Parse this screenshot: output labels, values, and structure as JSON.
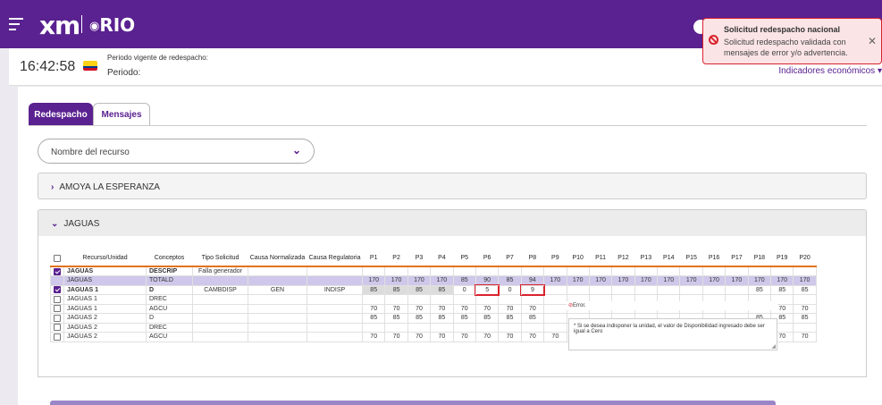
{
  "header": {
    "logo_left": "xm",
    "logo_right": "RIO"
  },
  "info": {
    "clock": "16:42:58",
    "period_title": "Periodo vigente de redespacho:",
    "period_label": "Periodo:",
    "indicators": "Indicadores económicos"
  },
  "tabs": [
    {
      "label": "Redespacho"
    },
    {
      "label": "Mensajes"
    }
  ],
  "filter": {
    "placeholder": "Nombre del recurso"
  },
  "accordions": [
    {
      "title": "AMOYA LA ESPERANZA"
    },
    {
      "title": "JAGUAS"
    }
  ],
  "table": {
    "headers": [
      "",
      "Recurso/Unidad",
      "Conceptos",
      "Tipo Solicitud",
      "Causa Normalizada",
      "Causa Regulatoria",
      "P1",
      "P2",
      "P3",
      "P4",
      "P5",
      "P6",
      "P7",
      "P8",
      "P9",
      "P10",
      "P11",
      "P12",
      "P13",
      "P14",
      "P15",
      "P16",
      "P17",
      "P18",
      "P19",
      "P20"
    ],
    "rows": [
      {
        "checked": true,
        "cells": [
          "JAGUAS",
          "DESCRIP",
          "Falla generador",
          "",
          "",
          "",
          "",
          "",
          "",
          "",
          "",
          "",
          "",
          "",
          "",
          "",
          "",
          "",
          "",
          "",
          "",
          "",
          "",
          "",
          ""
        ]
      },
      {
        "checked": null,
        "cells": [
          "JAGUAS",
          "TOTALD",
          "",
          "",
          "",
          "170",
          "170",
          "170",
          "170",
          "85",
          "90",
          "85",
          "94",
          "170",
          "170",
          "170",
          "170",
          "170",
          "170",
          "170",
          "170",
          "170",
          "170",
          "170",
          "170"
        ]
      },
      {
        "checked": true,
        "cells": [
          "JAGUAS 1",
          "D",
          "CAMBDISP",
          "GEN",
          "INDISP",
          "85",
          "85",
          "85",
          "85",
          "0",
          "5",
          "0",
          "9",
          "",
          "",
          "",
          "",
          "",
          "",
          "",
          "",
          "",
          "85",
          "85",
          "85"
        ]
      },
      {
        "checked": false,
        "cells": [
          "JAGUAS 1",
          "DREC",
          "",
          "",
          "",
          "",
          "",
          "",
          "",
          "",
          "",
          "",
          "",
          "",
          "",
          "",
          "",
          "",
          "",
          "",
          "",
          "",
          "",
          "",
          ""
        ]
      },
      {
        "checked": false,
        "cells": [
          "JAGUAS 1",
          "AGCU",
          "",
          "",
          "",
          "70",
          "70",
          "70",
          "70",
          "70",
          "70",
          "70",
          "70",
          "",
          "",
          "",
          "",
          "",
          "",
          "",
          "",
          "",
          "70",
          "70",
          "70"
        ]
      },
      {
        "checked": false,
        "cells": [
          "JAGUAS 2",
          "D",
          "",
          "",
          "",
          "85",
          "85",
          "85",
          "85",
          "85",
          "85",
          "85",
          "85",
          "",
          "",
          "",
          "",
          "",
          "",
          "",
          "",
          "",
          "85",
          "85",
          "85"
        ]
      },
      {
        "checked": false,
        "cells": [
          "JAGUAS 2",
          "DREC",
          "",
          "",
          "",
          "",
          "",
          "",
          "",
          "",
          "",
          "",
          "",
          "",
          "",
          "",
          "",
          "",
          "",
          "",
          "",
          "",
          "",
          "",
          ""
        ]
      },
      {
        "checked": false,
        "cells": [
          "JAGUAS 2",
          "AGCU",
          "",
          "",
          "",
          "70",
          "70",
          "70",
          "70",
          "70",
          "70",
          "70",
          "70",
          "70",
          "70",
          "70",
          "70",
          "70",
          "70",
          "70",
          "70",
          "70",
          "70",
          "70",
          "70"
        ]
      }
    ]
  },
  "popup": {
    "error_label": "Error.",
    "message": "* Si se desea indisponer la unidad, el valor de Disponibilidad ingresado debe ser igual a Cero"
  },
  "toast": {
    "title": "Solicitud redespacho nacional",
    "message": "Solicitud redespacho validada con mensajes de error y/o advertencia."
  },
  "colors": {
    "brand": "#5a2190",
    "error": "#d9232e",
    "accent": "#e4721a"
  }
}
